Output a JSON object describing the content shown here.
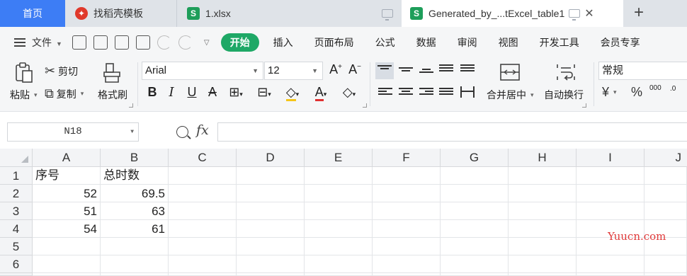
{
  "tabs": {
    "home": "首页",
    "template": "找稻壳模板",
    "file1": "1.xlsx",
    "file2": "Generated_by_...tExcel_table1",
    "new_tab": "+"
  },
  "menu": {
    "file": "文件",
    "items": [
      "开始",
      "插入",
      "页面布局",
      "公式",
      "数据",
      "审阅",
      "视图",
      "开发工具",
      "会员专享"
    ],
    "active": "开始"
  },
  "ribbon": {
    "paste": "粘贴",
    "cut": "剪切",
    "copy": "复制",
    "format_painter": "格式刷",
    "font_name": "Arial",
    "font_size": "12",
    "merge_center": "合并居中",
    "wrap_text": "自动换行",
    "number_format": "常规",
    "currency_symbol": "¥",
    "percent_symbol": "%",
    "thousands_symbol": "000",
    "decimal_symbol": ".0"
  },
  "formula_bar": {
    "name_box": "N18",
    "fx_label": "fx",
    "content": ""
  },
  "sheet": {
    "columns": [
      "A",
      "B",
      "C",
      "D",
      "E",
      "F",
      "G",
      "H",
      "I",
      "J"
    ],
    "rows": [
      "1",
      "2",
      "3",
      "4",
      "5",
      "6"
    ],
    "cells": [
      [
        "序号",
        "总时数"
      ],
      [
        "52",
        "69.5"
      ],
      [
        "51",
        "63"
      ],
      [
        "54",
        "61"
      ]
    ]
  },
  "watermark": "Yuucn.com",
  "colors": {
    "home_tab": "#3d7df5",
    "active_menu": "#1ea866",
    "sheet_icon": "#1e9e5a",
    "template_icon": "#e0392b",
    "watermark": "#e03a3a"
  }
}
